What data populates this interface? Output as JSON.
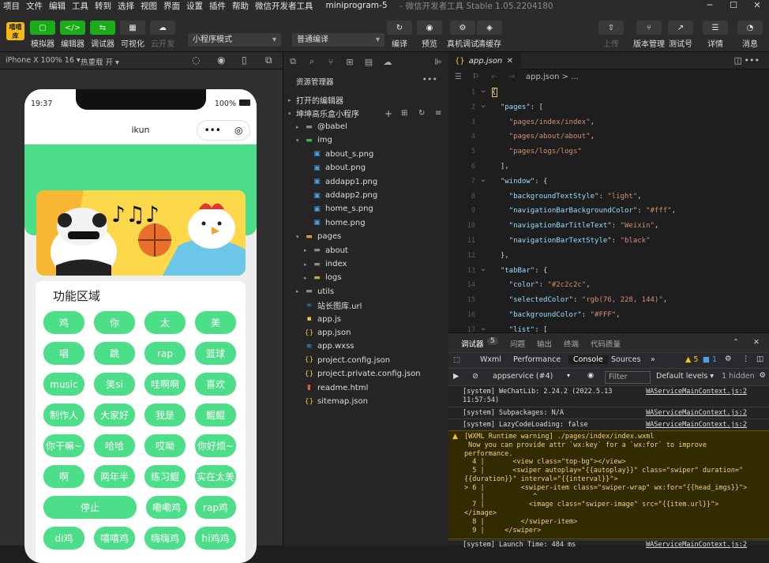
{
  "menubar": {
    "items": [
      "项目",
      "文件",
      "编辑",
      "工具",
      "转到",
      "选择",
      "视图",
      "界面",
      "设置",
      "插件",
      "帮助",
      "微信开发者工具"
    ],
    "project": "miniprogram-5",
    "title": "- 微信开发者工具 Stable 1.05.2204180"
  },
  "toolbar": {
    "logo": "嘻嘻 库",
    "left": [
      {
        "label": "模拟器",
        "icon": "▢"
      },
      {
        "label": "编辑器",
        "icon": "</>"
      },
      {
        "label": "调试器",
        "icon": "⇆"
      },
      {
        "label": "可视化",
        "icon": "▦"
      },
      {
        "label": "云开发",
        "icon": "☁"
      }
    ],
    "mode": "小程序模式",
    "compile": "普通编译",
    "center": [
      {
        "label": "编译",
        "icon": "↻"
      },
      {
        "label": "预览",
        "icon": "◉"
      },
      {
        "label": "真机调试",
        "icon": "⚙"
      },
      {
        "label": "清缓存",
        "icon": "◈"
      }
    ],
    "right": [
      {
        "label": "上传",
        "icon": "⇧"
      },
      {
        "label": "版本管理",
        "icon": "⑂"
      },
      {
        "label": "测试号",
        "icon": "↗"
      },
      {
        "label": "详情",
        "icon": "☰"
      },
      {
        "label": "消息",
        "icon": "◔"
      }
    ]
  },
  "simulator": {
    "device": "iPhone X 100% 16 ▾",
    "hotreload": "热重载 开 ▾",
    "time": "19:37",
    "battery": "100%",
    "nav_title": "ikun",
    "capsule_more": "•••",
    "capsule_close": "◎"
  },
  "func": {
    "title": "功能区域",
    "buttons": [
      "鸡",
      "你",
      "太",
      "美",
      "唱",
      "跳",
      "rap",
      "篮球",
      "music",
      "笑si",
      "哇啊啊",
      "喜欢",
      "制作人",
      "大家好",
      "我是",
      "鲲鲲",
      "你干嘛~",
      "哈哈",
      "哎呦",
      "你好烦~",
      "啊",
      "两年半",
      "练习鲲",
      "实在太美",
      "停止",
      "嘞嘞鸡",
      "rap鸡",
      "di鸡",
      "嘻嘻鸡",
      "嗨嗨鸡",
      "hi鸡鸡"
    ]
  },
  "explorer": {
    "tabs": [
      "⧉",
      "⌕",
      "⑂",
      "⊞",
      "▤",
      "☁",
      "⊫"
    ],
    "title": "资源管理器",
    "more": "•••",
    "open_editors": "打开的编辑器",
    "project": "坤坤高乐盒小程序",
    "tree": [
      {
        "name": "@babel",
        "indent": 1,
        "arrow": "▸",
        "icon": "▬",
        "ic": "#8a8a8a"
      },
      {
        "name": "img",
        "indent": 1,
        "arrow": "▾",
        "icon": "▬",
        "ic": "#3bb54a"
      },
      {
        "name": "about_s.png",
        "indent": 2,
        "arrow": "",
        "icon": "▣",
        "ic": "#4aa3df"
      },
      {
        "name": "about.png",
        "indent": 2,
        "arrow": "",
        "icon": "▣",
        "ic": "#4aa3df"
      },
      {
        "name": "addapp1.png",
        "indent": 2,
        "arrow": "",
        "icon": "▣",
        "ic": "#4aa3df"
      },
      {
        "name": "addapp2.png",
        "indent": 2,
        "arrow": "",
        "icon": "▣",
        "ic": "#4aa3df"
      },
      {
        "name": "home_s.png",
        "indent": 2,
        "arrow": "",
        "icon": "▣",
        "ic": "#4aa3df"
      },
      {
        "name": "home.png",
        "indent": 2,
        "arrow": "",
        "icon": "▣",
        "ic": "#4aa3df"
      },
      {
        "name": "pages",
        "indent": 1,
        "arrow": "▾",
        "icon": "▬",
        "ic": "#e8954a"
      },
      {
        "name": "about",
        "indent": 2,
        "arrow": "▸",
        "icon": "▬",
        "ic": "#8a8a8a"
      },
      {
        "name": "index",
        "indent": 2,
        "arrow": "▸",
        "icon": "▬",
        "ic": "#8a8a8a"
      },
      {
        "name": "logs",
        "indent": 2,
        "arrow": "▸",
        "icon": "▬",
        "ic": "#c8a832"
      },
      {
        "name": "utils",
        "indent": 1,
        "arrow": "▸",
        "icon": "▬",
        "ic": "#8a8a8a"
      },
      {
        "name": "站长图库.url",
        "indent": 1,
        "arrow": "",
        "icon": "∞",
        "ic": "#4aa3df"
      },
      {
        "name": "app.js",
        "indent": 1,
        "arrow": "",
        "icon": "▪",
        "ic": "#e8c84a"
      },
      {
        "name": "app.json",
        "indent": 1,
        "arrow": "",
        "icon": "{}",
        "ic": "#e8c84a"
      },
      {
        "name": "app.wxss",
        "indent": 1,
        "arrow": "",
        "icon": "≋",
        "ic": "#4aa3df"
      },
      {
        "name": "project.config.json",
        "indent": 1,
        "arrow": "",
        "icon": "{}",
        "ic": "#e8c84a"
      },
      {
        "name": "project.private.config.json",
        "indent": 1,
        "arrow": "",
        "icon": "{}",
        "ic": "#e8c84a"
      },
      {
        "name": "readme.html",
        "indent": 1,
        "arrow": "",
        "icon": "▮",
        "ic": "#e05a3a"
      },
      {
        "name": "sitemap.json",
        "indent": 1,
        "arrow": "",
        "icon": "{}",
        "ic": "#e8c84a"
      }
    ]
  },
  "editor": {
    "tab": "app.json",
    "close": "✕",
    "breadcrumb": "app.json > ...",
    "lines": [
      [
        [
          "p",
          "{"
        ]
      ],
      [
        [
          "k",
          "  \"pages\""
        ],
        [
          "p",
          ": ["
        ]
      ],
      [
        [
          "s",
          "    \"pages/index/index\""
        ],
        [
          "p",
          ","
        ]
      ],
      [
        [
          "s",
          "    \"pages/about/about\""
        ],
        [
          "p",
          ","
        ]
      ],
      [
        [
          "s",
          "    \"pages/logs/logs\""
        ]
      ],
      [
        [
          "p",
          "  ],"
        ]
      ],
      [
        [
          "k",
          "  \"window\""
        ],
        [
          "p",
          ": {"
        ]
      ],
      [
        [
          "k",
          "    \"backgroundTextStyle\""
        ],
        [
          "p",
          ": "
        ],
        [
          "s",
          "\"light\""
        ],
        [
          "p",
          ","
        ]
      ],
      [
        [
          "k",
          "    \"navigationBarBackgroundColor\""
        ],
        [
          "p",
          ": "
        ],
        [
          "s",
          "\"#fff\""
        ],
        [
          "p",
          ","
        ]
      ],
      [
        [
          "k",
          "    \"navigationBarTitleText\""
        ],
        [
          "p",
          ": "
        ],
        [
          "s",
          "\"Weixin\""
        ],
        [
          "p",
          ","
        ]
      ],
      [
        [
          "k",
          "    \"navigationBarTextStyle\""
        ],
        [
          "p",
          ": "
        ],
        [
          "s",
          "\"black\""
        ]
      ],
      [
        [
          "p",
          "  },"
        ]
      ],
      [
        [
          "k",
          "  \"tabBar\""
        ],
        [
          "p",
          ": {"
        ]
      ],
      [
        [
          "k",
          "    \"color\""
        ],
        [
          "p",
          ": "
        ],
        [
          "s",
          "\"#2c2c2c\""
        ],
        [
          "p",
          ","
        ]
      ],
      [
        [
          "k",
          "    \"selectedColor\""
        ],
        [
          "p",
          ": "
        ],
        [
          "s",
          "\"rgb(76, 228, 144)\""
        ],
        [
          "p",
          ","
        ]
      ],
      [
        [
          "k",
          "    \"backgroundColor\""
        ],
        [
          "p",
          ": "
        ],
        [
          "s",
          "\"#FFF\""
        ],
        [
          "p",
          ","
        ]
      ],
      [
        [
          "k",
          "    \"list\""
        ],
        [
          "p",
          ": ["
        ]
      ]
    ]
  },
  "console": {
    "tabs1": [
      "调试器",
      "问题",
      "输出",
      "终端",
      "代码质量"
    ],
    "badge": "5",
    "tabs2": [
      "Wxml",
      "Performance",
      "Console",
      "Sources"
    ],
    "active": "Console",
    "warn_count": "▲ 5",
    "info_count": "■ 1",
    "context": "appservice (#4)",
    "filter": "Filter",
    "levels": "Default levels ▾",
    "hidden": "1 hidden",
    "logs": [
      {
        "text": "[system] WeChatLib: 2.24.2 (2022.5.13\n11:57:54)",
        "src": "WAServiceMainContext.js:2"
      },
      {
        "text": "[system] Subpackages: N/A",
        "src": "WAServiceMainContext.js:2"
      },
      {
        "text": "[system] LazyCodeLoading: false",
        "src": "WAServiceMainContext.js:2"
      }
    ],
    "warning": "[WXML Runtime warning] ./pages/index/index.wxml\n Now you can provide attr `wx:key` for a `wx:for` to improve\nperformance.\n  4 |       <view class=\"top-bg\"></view>\n  5 |       <swiper autoplay=\"{{autoplay}}\" class=\"swiper\" duration=\"\n{{duration}}\" interval=\"{{interval}}\">\n> 6 |         <swiper-item class=\"swiper-wrap\" wx:for=\"{{head_imgs}}\">\n    |            ^\n  7 |           <image class=\"swiper-image\" src=\"{{item.url}}\">\n</image>\n  8 |         </swiper-item>\n  9 |     </swiper>",
    "last": "[system] Launch Time: 484 ms",
    "last_src": "WAServiceMainContext.js:2"
  },
  "colors": {
    "accent": "#1aad19",
    "kun_green": "#4cde88"
  }
}
